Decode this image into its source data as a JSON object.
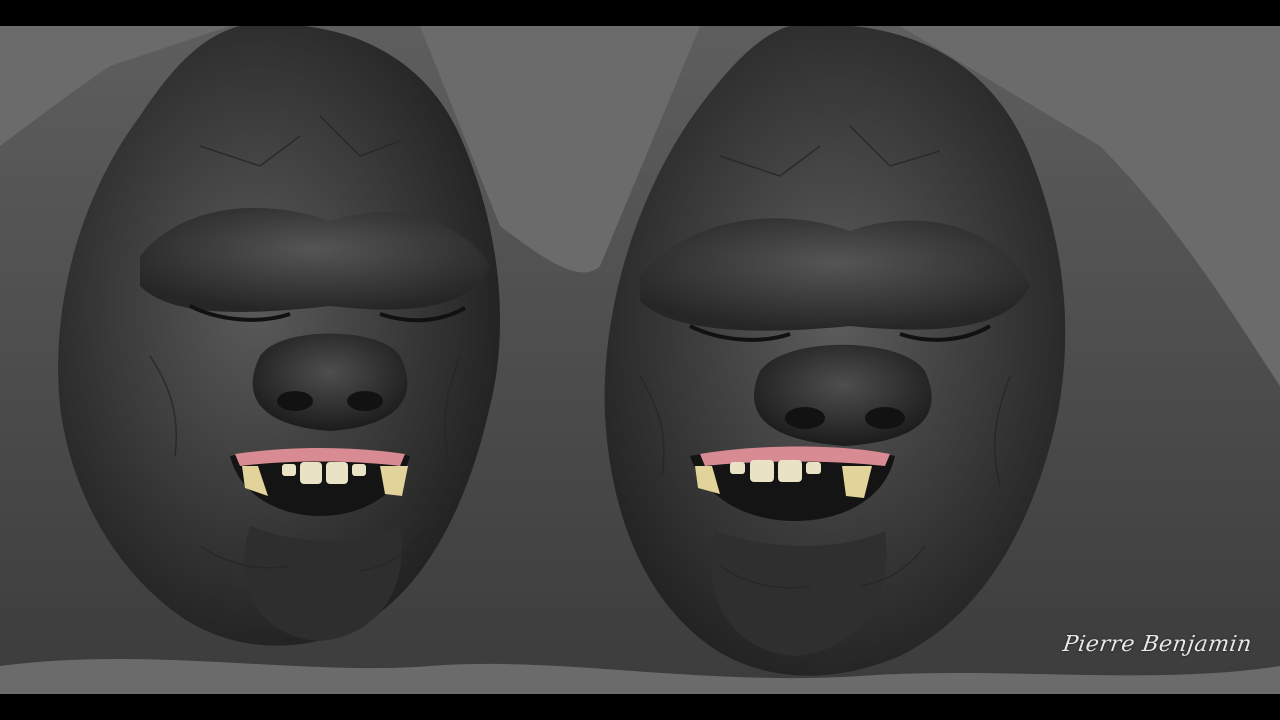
{
  "image": {
    "subject": "two-gorilla-sculpt-renders",
    "background_color": "#6b6b6b",
    "letterbox_color": "#000000"
  },
  "watermark": {
    "text": "Pierre Benjamin"
  }
}
